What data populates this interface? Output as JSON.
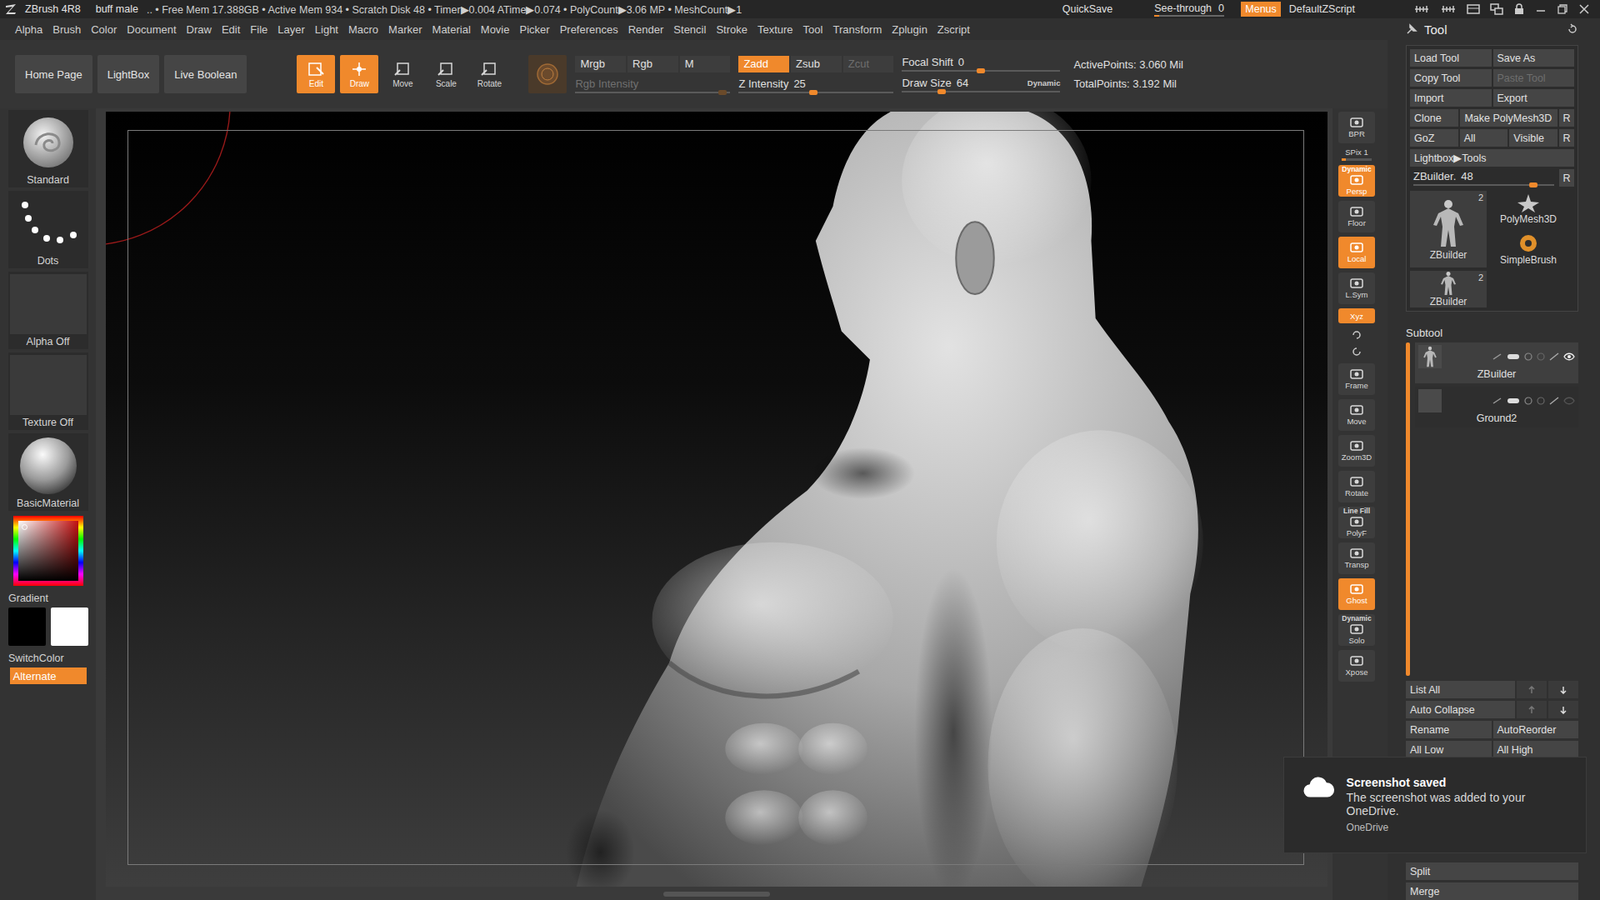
{
  "title_bar": {
    "app": "ZBrush 4R8",
    "document": "buff male",
    "stats": ".. • Free Mem 17.388GB • Active Mem 934 • Scratch Disk 48 • Timer▶0.004 ATime▶0.074 • PolyCount▶3.06 MP • MeshCount▶1",
    "quicksave": "QuickSave",
    "see_through": {
      "label": "See-through",
      "value": "0",
      "level": 0
    },
    "menus": {
      "label": "Menus",
      "on": true
    },
    "script": "DefaultZScript"
  },
  "menu": [
    "Alpha",
    "Brush",
    "Color",
    "Document",
    "Draw",
    "Edit",
    "File",
    "Layer",
    "Light",
    "Macro",
    "Marker",
    "Material",
    "Movie",
    "Picker",
    "Preferences",
    "Render",
    "Stencil",
    "Stroke",
    "Texture",
    "Tool",
    "Transform",
    "Zplugin",
    "Zscript"
  ],
  "shelf": {
    "nav": [
      "Home Page",
      "LightBox",
      "Live Boolean"
    ],
    "tools": [
      {
        "label": "Edit",
        "on": true
      },
      {
        "label": "Draw",
        "on": true
      },
      {
        "label": "Move",
        "on": false
      },
      {
        "label": "Scale",
        "on": false
      },
      {
        "label": "Rotate",
        "on": false
      }
    ],
    "color_modes": [
      {
        "label": "Mrgb",
        "on": false,
        "disabled": false
      },
      {
        "label": "Rgb",
        "on": false,
        "disabled": false
      },
      {
        "label": "M",
        "on": false,
        "disabled": false
      }
    ],
    "rgb_intensity": {
      "label": "Rgb Intensity",
      "level": 0.95,
      "disabled": true
    },
    "z_modes": [
      {
        "label": "Zadd",
        "on": true,
        "disabled": false
      },
      {
        "label": "Zsub",
        "on": false,
        "disabled": false
      },
      {
        "label": "Zcut",
        "on": false,
        "disabled": true
      }
    ],
    "z_intensity": {
      "label": "Z Intensity",
      "value": "25",
      "level": 0.48,
      "disabled": false
    },
    "focal_shift": {
      "label": "Focal Shift",
      "value": "0",
      "level": 0.5,
      "disabled": false
    },
    "draw_size": {
      "label": "Draw Size",
      "value": "64",
      "extra": "Dynamic",
      "level": 0.25,
      "disabled": false
    },
    "points": [
      "ActivePoints: 3.060 Mil",
      "TotalPoints: 3.192 Mil"
    ]
  },
  "left_shelf": {
    "brush": "Standard",
    "stroke": "Dots",
    "alpha": "Alpha Off",
    "texture": "Texture Off",
    "material": "BasicMaterial",
    "gradient": "Gradient",
    "swatches": [
      {
        "name": "main",
        "color": "#000000"
      },
      {
        "name": "secondary",
        "color": "#ffffff"
      }
    ],
    "switch_color": "SwitchColor",
    "alternate": {
      "label": "Alternate",
      "on": true
    }
  },
  "right_shelf": [
    {
      "label": "BPR",
      "top": "",
      "on": false,
      "kind": "button"
    },
    {
      "label": "SPix 1",
      "top": "",
      "on": false,
      "kind": "slider",
      "level": 0.15
    },
    {
      "label": "Persp",
      "top": "Dynamic",
      "on": true,
      "kind": "button"
    },
    {
      "label": "Floor",
      "top": "",
      "on": false,
      "kind": "button"
    },
    {
      "label": "Local",
      "top": "",
      "on": true,
      "kind": "button"
    },
    {
      "label": "L.Sym",
      "top": "",
      "on": false,
      "kind": "button"
    },
    {
      "label": "Xyz",
      "top": "",
      "on": true,
      "kind": "small"
    },
    {
      "label": "",
      "top": "",
      "on": false,
      "kind": "mini"
    },
    {
      "label": "Frame",
      "top": "",
      "on": false,
      "kind": "button"
    },
    {
      "label": "Move",
      "top": "",
      "on": false,
      "kind": "button"
    },
    {
      "label": "Zoom3D",
      "top": "",
      "on": false,
      "kind": "button"
    },
    {
      "label": "Rotate",
      "top": "",
      "on": false,
      "kind": "button"
    },
    {
      "label": "PolyF",
      "top": "Line Fill",
      "on": false,
      "kind": "button"
    },
    {
      "label": "Transp",
      "top": "",
      "on": false,
      "kind": "button"
    },
    {
      "label": "Ghost",
      "top": "",
      "on": true,
      "kind": "button"
    },
    {
      "label": "Solo",
      "top": "Dynamic",
      "on": false,
      "kind": "button"
    },
    {
      "label": "Xpose",
      "top": "",
      "on": false,
      "kind": "button"
    }
  ],
  "tool_panel": {
    "title": "Tool",
    "rows": [
      [
        {
          "label": "Load Tool",
          "kind": "normal",
          "disabled": false
        },
        {
          "label": "Save As",
          "kind": "normal",
          "disabled": false
        }
      ],
      [
        {
          "label": "Copy Tool",
          "kind": "normal",
          "disabled": false
        },
        {
          "label": "Paste Tool",
          "kind": "normal",
          "disabled": true
        }
      ],
      [
        {
          "label": "Import",
          "kind": "normal",
          "disabled": false
        },
        {
          "label": "Export",
          "kind": "normal",
          "disabled": false
        }
      ],
      [
        {
          "label": "Clone",
          "kind": "normal",
          "disabled": false
        },
        {
          "label": "Make PolyMesh3D",
          "kind": "wide",
          "disabled": false
        },
        {
          "label": "R",
          "kind": "small",
          "disabled": false
        }
      ],
      [
        {
          "label": "GoZ",
          "kind": "normal",
          "disabled": false
        },
        {
          "label": "All",
          "kind": "normal",
          "disabled": false
        },
        {
          "label": "Visible",
          "kind": "normal",
          "disabled": false
        },
        {
          "label": "R",
          "kind": "small",
          "disabled": false
        }
      ],
      [
        {
          "label": "Lightbox▶Tools",
          "kind": "normal",
          "disabled": false
        }
      ]
    ],
    "tool_slider": {
      "label": "ZBuilder.",
      "value": "48",
      "level": 0.85,
      "disabled": false,
      "reset": "R"
    },
    "current": {
      "name": "ZBuilder",
      "count": "2",
      "selected": true
    },
    "recent": [
      {
        "name": "PolyMesh3D",
        "count": "",
        "kind": "star"
      },
      {
        "name": "SimpleBrush",
        "count": "",
        "kind": "brush"
      },
      {
        "name": "ZBuilder",
        "count": "2",
        "kind": "figure"
      }
    ],
    "subtool": {
      "title": "Subtool",
      "items": [
        {
          "name": "ZBuilder",
          "selected": true,
          "visible": true
        },
        {
          "name": "Ground2",
          "selected": false,
          "visible": false
        }
      ],
      "actions": [
        {
          "kind": "arrows",
          "labels": [
            "List All"
          ]
        },
        {
          "kind": "arrows",
          "labels": [
            "Auto Collapse"
          ]
        },
        {
          "kind": "pair",
          "labels": [
            "Rename",
            "AutoReorder"
          ]
        },
        {
          "kind": "pair",
          "labels": [
            "All Low",
            "All High"
          ]
        },
        {
          "kind": "full",
          "labels": [
            "Split"
          ]
        },
        {
          "kind": "full",
          "labels": [
            "Merge"
          ]
        }
      ]
    }
  },
  "toast": {
    "title": "Screenshot saved",
    "message": "The screenshot was added to your OneDrive.",
    "source": "OneDrive"
  }
}
